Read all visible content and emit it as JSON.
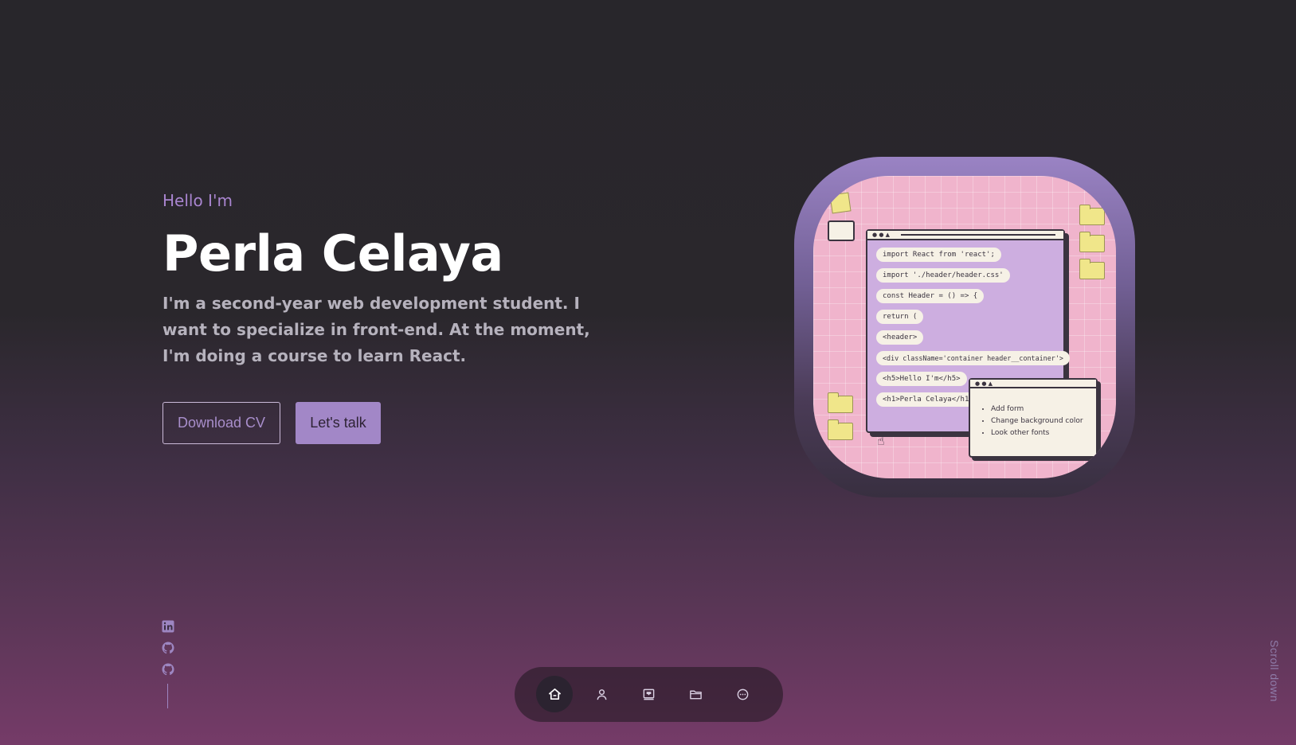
{
  "hero": {
    "greeting": "Hello I'm",
    "name": "Perla Celaya",
    "description": "I'm a second-year web development student. I want to specialize in front-end. At the moment, I'm doing a course to learn React.",
    "download_cv_label": "Download CV",
    "lets_talk_label": "Let's talk"
  },
  "illustration": {
    "code_lines": [
      "import React from 'react';",
      "import './header/header.css'",
      "const Header = () => {",
      "return (",
      "<header>",
      "<div className='container header__container'>",
      "<h5>Hello I'm</h5>",
      "<h1>Perla Celaya</h1>"
    ],
    "todo_items": [
      "Add form",
      "Change background color",
      "Look other fonts"
    ]
  },
  "socials": {
    "items": [
      {
        "icon": "linkedin-icon"
      },
      {
        "icon": "github-icon"
      },
      {
        "icon": "github-icon"
      }
    ]
  },
  "nav": {
    "items": [
      {
        "icon": "home-icon",
        "active": true
      },
      {
        "icon": "user-icon",
        "active": false
      },
      {
        "icon": "experience-icon",
        "active": false
      },
      {
        "icon": "folder-icon",
        "active": false
      },
      {
        "icon": "message-icon",
        "active": false
      }
    ]
  },
  "scroll_down_label": "Scroll down",
  "colors": {
    "accent": "#a287c7",
    "background_top": "#28262b",
    "background_bottom": "#753b68"
  }
}
